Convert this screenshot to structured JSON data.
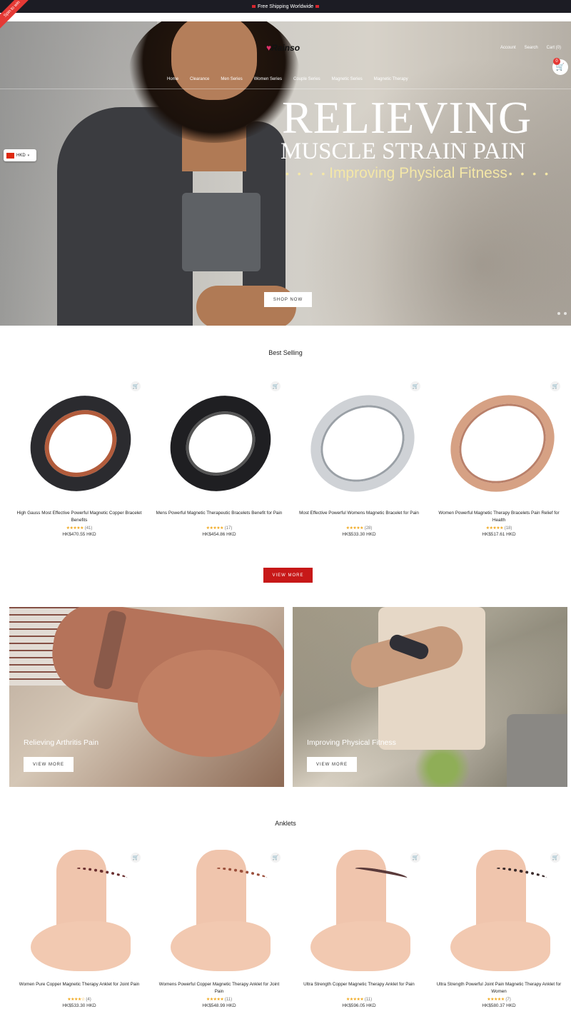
{
  "topbar": {
    "text": "Free Shipping Worldwide"
  },
  "promo_ribbon": "Spin to win",
  "header": {
    "logo": "Rainso",
    "account": "Account",
    "search": "Search",
    "cart": "Cart (0)",
    "cart_count": "0",
    "nav": [
      "Home",
      "Clearance",
      "Men Series",
      "Women Series",
      "Couple Series",
      "Magnetic Series",
      "Magnetic Therapy"
    ]
  },
  "currency": {
    "code": "HKD"
  },
  "hero": {
    "line1": "RELIEVING",
    "line2": "MUSCLE STRAIN PAIN",
    "line3": "Improving Physical Fitness",
    "dots": "• • • •",
    "button": "SHOP NOW"
  },
  "best_selling": {
    "title": "Best Selling",
    "products": [
      {
        "name": "High Gauss Most Effective Powerful Magnetic Copper Bracelet Benefits",
        "stars": "★★★★★",
        "reviews": "(41)",
        "price": "HK$470.55 HKD"
      },
      {
        "name": "Mens Powerful Magnetic Therapeutic Bracelets Benefit for Pain",
        "stars": "★★★★★",
        "reviews": "(17)",
        "price": "HK$454.86 HKD"
      },
      {
        "name": "Most Effective Powerful Womens Magnetic Bracelet for Pain",
        "stars": "★★★★★",
        "reviews": "(28)",
        "price": "HK$533.30 HKD"
      },
      {
        "name": "Women Powerful Magnetic Therapy Bracelets Pain Relief for Health",
        "stars": "★★★★★",
        "reviews": "(18)",
        "price": "HK$517.61 HKD"
      }
    ],
    "button": "VIEW MORE"
  },
  "promos": [
    {
      "title": "Relieving Arthritis Pain",
      "button": "VIEW MORE"
    },
    {
      "title": "Improving Physical Fitness",
      "button": "VIEW MORE"
    }
  ],
  "anklets": {
    "title": "Anklets",
    "products": [
      {
        "name": "Women Pure Copper Magnetic Therapy Anklet for Joint Pain",
        "stars": "★★★★☆",
        "reviews": "(4)",
        "price": "HK$533.30 HKD"
      },
      {
        "name": "Womens Powerful Copper Magnetic Therapy Anklet for Joint Pain",
        "stars": "★★★★★",
        "reviews": "(11)",
        "price": "HK$548.99 HKD"
      },
      {
        "name": "Ultra Strength Copper Magnetic Therapy Anklet for Pain",
        "stars": "★★★★★",
        "reviews": "(11)",
        "price": "HK$596.05 HKD"
      },
      {
        "name": "Ultra Strength Powerful Joint Pain Magnetic Therapy Anklet for Women",
        "stars": "★★★★★",
        "reviews": "(7)",
        "price": "HK$580.37 HKD"
      }
    ]
  },
  "icons": {
    "cart": "cart-icon",
    "caret": "chevron-down-icon",
    "flag": "hk-flag-icon"
  }
}
